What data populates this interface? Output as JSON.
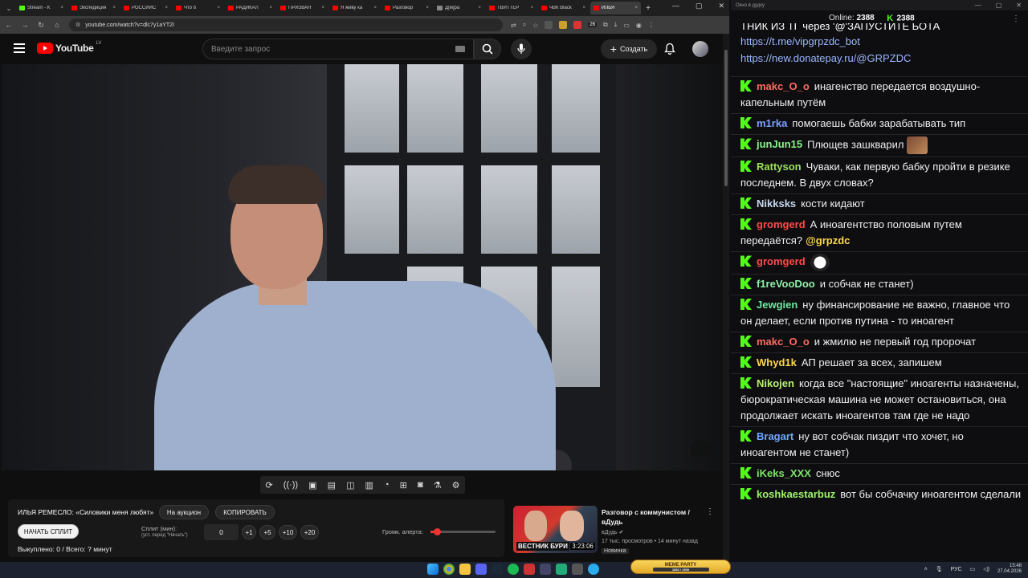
{
  "browser": {
    "tabs": [
      {
        "label": "Stream - K",
        "color": "#53fc18",
        "active": false
      },
      {
        "label": "Экспедиция",
        "color": "#f00",
        "active": false
      },
      {
        "label": "РОССИЙС",
        "color": "#f00",
        "active": false
      },
      {
        "label": "Что б",
        "color": "#f00",
        "active": false
      },
      {
        "label": "РАДИКАЛ",
        "color": "#f00",
        "active": false
      },
      {
        "label": "ПРИЗВАН",
        "color": "#f00",
        "active": false
      },
      {
        "label": "Я живу ка",
        "color": "#f00",
        "active": false
      },
      {
        "label": "Разговор",
        "color": "#f00",
        "active": false
      },
      {
        "label": "Д[м]ра",
        "color": "#888",
        "active": false
      },
      {
        "label": "ТВИТТЕР",
        "color": "#f00",
        "active": false
      },
      {
        "label": "ЧВК Black",
        "color": "#f00",
        "active": false
      },
      {
        "label": "ИЛЬЯ",
        "color": "#f00",
        "active": true
      }
    ],
    "url": "youtube.com/watch?v=dlc7y1aYT2I",
    "badge": "26"
  },
  "youtube": {
    "logo_text": "YouTube",
    "logo_region": "LV",
    "search_placeholder": "Введите запрос",
    "create_label": "Создать"
  },
  "panel": {
    "title": "ИЛЬЯ РЕМЕСЛО: «Силовики меня любят»",
    "auction_label": "На аукцион",
    "copy_label": "КОПИРОВАТЬ",
    "start_split_label": "НАЧАТЬ СПЛИТ",
    "split_label": "Сплит (мин):",
    "split_hint": "(уст. перед \"Начать\")",
    "split_value": "0",
    "increments": [
      "+1",
      "+5",
      "+10",
      "+20"
    ],
    "alert_label": "Громк. алерта:",
    "alert_volume": 0.1,
    "footer": "Выкуплено: 0 / Всего: ? минут"
  },
  "recommendation": {
    "title": "Разговор с коммунистом / вДудь",
    "channel": "вДудь",
    "meta": "17 тыс. просмотров • 14 минут назад",
    "badge": "Новинка",
    "thumb_label": "ВЕСТНИК БУРИ",
    "duration": "3:23:06"
  },
  "chat": {
    "window_title": "Окно в дудку",
    "online_label": "Online:",
    "online_count": "2388",
    "kick_count": "2388",
    "pinned_head": "ТНИК ИЗ ТГ через '@'ЗАПУСТИТЕ БОТА",
    "pinned_links": [
      "https://t.me/vipgrpzdc_bot",
      "https://new.donatepay.ru/@GRPZDC"
    ],
    "messages": [
      {
        "user": "makc_O_o",
        "color": "#ff6a5e",
        "text": "инагенство передается воздушно-капельным путём"
      },
      {
        "user": "m1rka",
        "color": "#7fa0ff",
        "text": "помогаешь бабки зарабатывать тип"
      },
      {
        "user": "junJun15",
        "color": "#8bf28b",
        "text": "Плющев зашкварил"
      },
      {
        "user": "Rattyson",
        "color": "#9be25a",
        "text": "Чуваки, как первую бабку пройти в резике последнем. В двух словах?"
      },
      {
        "user": "Nikksks",
        "color": "#c8d8f0",
        "text": "кости кидают"
      },
      {
        "user": "gromgerd",
        "color": "#ff4a4a",
        "text": "А иноагентство половым путем передаётся?",
        "mention": "@grpzdc"
      },
      {
        "user": "gromgerd",
        "color": "#ff4a4a",
        "text": ""
      },
      {
        "user": "f1reVooDoo",
        "color": "#8ff0a8",
        "text": "и собчак не станет)"
      },
      {
        "user": "Jewgien",
        "color": "#6fe8a0",
        "text": "ну финансирование не важно, главное что он делает, если против путина - то иноагент"
      },
      {
        "user": "makc_O_o",
        "color": "#ff6a5e",
        "text": "и жмилю не первый год пророчат"
      },
      {
        "user": "Whyd1k",
        "color": "#ffd84a",
        "text": "АП решает за всех, запишем"
      },
      {
        "user": "Nikojen",
        "color": "#b8f070",
        "text": "когда все \"настоящие\" иноагенты назначены, бюрократическая машина не может остановиться, она продолжает искать иноагентов там где не надо"
      },
      {
        "user": "Bragart",
        "color": "#6fa8ff",
        "text": "ну вот собчак пиздит что хочет, но иноагентом не станет)"
      },
      {
        "user": "iKeks_XXX",
        "color": "#7fe36a",
        "text": "снюс"
      },
      {
        "user": "koshkaestarbuz",
        "color": "#9ff06a",
        "text": "вот бы собчачку иноагентом сделали"
      }
    ]
  },
  "taskbar": {
    "meme_label": "MEME PARTY",
    "meme_progress": "1852 / 1500",
    "lang": "РУС",
    "time": "15:48",
    "date": "27.04.2026"
  }
}
